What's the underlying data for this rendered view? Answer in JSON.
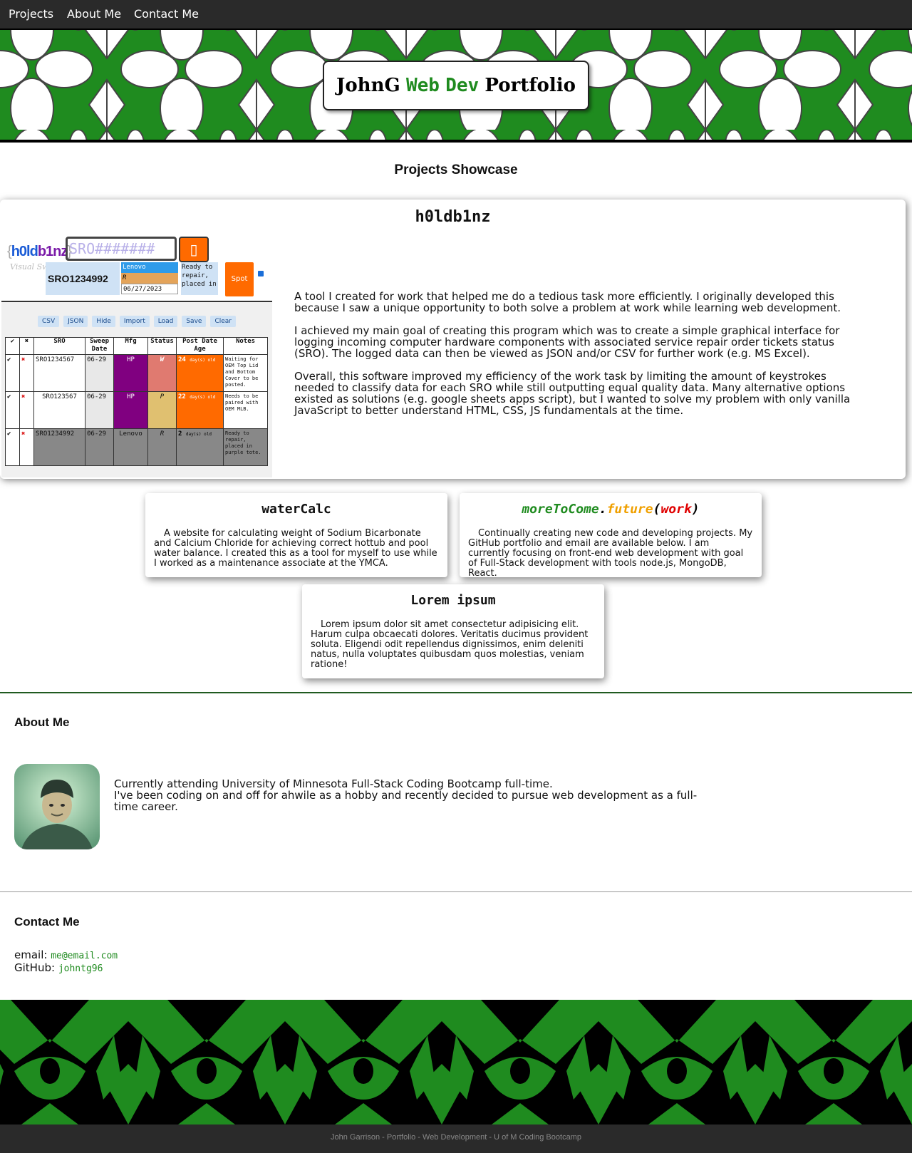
{
  "nav": {
    "items": [
      {
        "label": "Projects"
      },
      {
        "label": "About Me"
      },
      {
        "label": "Contact Me"
      }
    ]
  },
  "header": {
    "title_part1": "JohnG",
    "title_part2": "Web",
    "title_part3": "Dev",
    "title_part4": "Portfolio"
  },
  "showcase": {
    "heading": "Projects Showcase",
    "main_project": {
      "title": "h0ldb1nz",
      "paragraphs": [
        "A tool I created for work that helped me do a tedious task more efficiently. I originally developed this because I saw a unique opportunity to both solve a problem at work while learning web development.",
        "I achieved my main goal of creating this program which was to create a simple graphical interface for logging incoming computer hardware components with associated service repair order tickets status (SRO). The logged data can then be viewed as JSON and/or CSV for further work (e.g. MS Excel).",
        "Overall, this software improved my efficiency of the work task by limiting the amount of keystrokes needed to classify data for each SRO while still outputting equal quality data. Many alternative options existed as solutions (e.g. google sheets apps script), but I wanted to solve my problem with only vanilla JavaScript to better understand HTML, CSS, JS fundamentals at the time."
      ],
      "screenshot": {
        "logo_open": "{",
        "logo_a": "h0ld",
        "logo_b": "b1nz",
        "logo_close": "}",
        "sro_placeholder": "SRO#######",
        "sro_button_icon": "trash-icon",
        "visual_sweep": "Visual Sweep",
        "sro_value": "SRO1234992",
        "mfg_value": "Lenovo",
        "status_value": "R",
        "date_value": "06/27/2023",
        "note_value": "Ready to repair, placed in",
        "spot_label": "Spot",
        "toolbar": [
          "CSV",
          "JSON",
          "Hide",
          "Import",
          "Load",
          "Save",
          "Clear"
        ],
        "table_headers": [
          "✔",
          "✖",
          "SRO",
          "Sweep Date",
          "Mfg",
          "Status",
          "Post Date Age",
          "Notes"
        ],
        "rows": [
          {
            "sro": "SRO1234567",
            "date": "06-29",
            "mfg": "HP",
            "status": "W",
            "age_num": "24",
            "age_txt": "day(s) old",
            "notes": "Waiting for OEM Top Lid and Bottom Cover to be posted."
          },
          {
            "sro": "SRO123567",
            "date": "06-29",
            "mfg": "HP",
            "status": "P",
            "age_num": "22",
            "age_txt": "day(s) old",
            "notes": "Needs to be paired with OEM MLB."
          },
          {
            "sro": "SRO1234992",
            "date": "06-29",
            "mfg": "Lenovo",
            "status": "R",
            "age_num": "2",
            "age_txt": "day(s) old",
            "notes": "Ready to repair, placed in purple tote."
          }
        ]
      }
    },
    "cards": [
      {
        "title": "waterCalc",
        "text": "A website for calculating weight of Sodium Bicarbonate and Calcium Chloride for achieving correct hottub and pool water balance. I created this as a tool for myself to use while I worked as a maintenance associate at the YMCA."
      },
      {
        "title_a": "moreToCome",
        "title_b": ".",
        "title_c": "future",
        "title_d": "(",
        "title_e": "work",
        "title_f": ")",
        "text": "Continually creating new code and developing projects. My GitHub portfolio and email are available below. I am currently focusing on front-end web development with goal of Full-Stack development with tools node.js, MongoDB, React."
      },
      {
        "title": "Lorem ipsum",
        "text": "Lorem ipsum dolor sit amet consectetur adipisicing elit. Harum culpa obcaecati dolores. Veritatis ducimus provident soluta. Eligendi odit repellendus dignissimos, enim deleniti natus, nulla voluptates quibusdam quos molestias, veniam ratione!"
      }
    ]
  },
  "about": {
    "heading": "About Me",
    "line1": "Currently attending University of Minnesota Full-Stack Coding Bootcamp full-time.",
    "line2": "I've been coding on and off for ahwile as a hobby and recently decided to pursue web development as a full-time career."
  },
  "contact": {
    "heading": "Contact Me",
    "email_label": "email:",
    "email_value": "me@email.com",
    "github_label": "GitHub:",
    "github_value": "johntg96"
  },
  "footer": {
    "text": "John Garrison - Portfolio - Web Development - U of M Coding Bootcamp"
  },
  "colors": {
    "accent_green": "#1f8b1f",
    "nav_bg": "#2a2a2a",
    "orange": "#ff6a00"
  }
}
